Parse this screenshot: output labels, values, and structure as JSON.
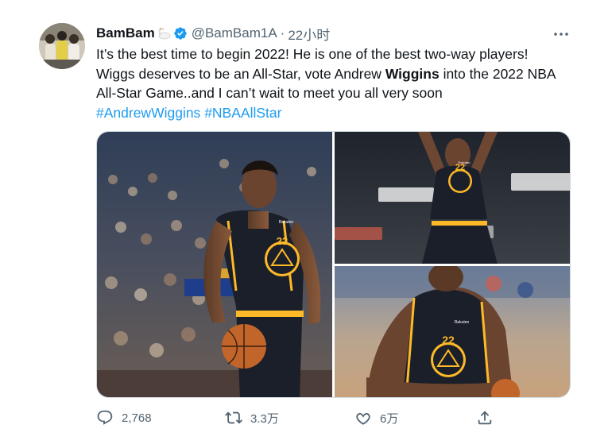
{
  "author": {
    "display_name": "BamBam",
    "name_emoji": "swan-emoji",
    "verified": true,
    "handle": "@BamBam1A",
    "separator": "·",
    "time": "22小时"
  },
  "tweet": {
    "line1": "It’s the best time to begin 2022! He is one of the best two-way players!",
    "line2": "Wiggs deserves to be an All-Star, vote Andrew ",
    "line2_bold": "Wiggins",
    "line2_end": " into the 2022 NBA",
    "line3": "All-Star Game..and I can’t wait to meet you all very soon",
    "hashtags": [
      "#AndrewWiggins",
      "#NBAAllStar"
    ]
  },
  "media": {
    "photos": [
      {
        "jersey_number": "22",
        "jersey_brand": "Rakuten"
      },
      {
        "jersey_number": "22",
        "jersey_brand": "Rakuten"
      },
      {
        "jersey_number": "22",
        "jersey_brand": "Rakuten"
      }
    ]
  },
  "metrics": {
    "replies": "2,768",
    "retweets": "3.3万",
    "likes": "6万"
  },
  "colors": {
    "link": "#1d9bf0",
    "verified": "#1d9bf0",
    "secondary_text": "#536471",
    "jersey_dark": "#1b1f2a",
    "jersey_gold": "#fdb927"
  },
  "icons": [
    "more-icon",
    "verified-badge-icon",
    "reply-icon",
    "retweet-icon",
    "like-icon",
    "share-icon"
  ]
}
